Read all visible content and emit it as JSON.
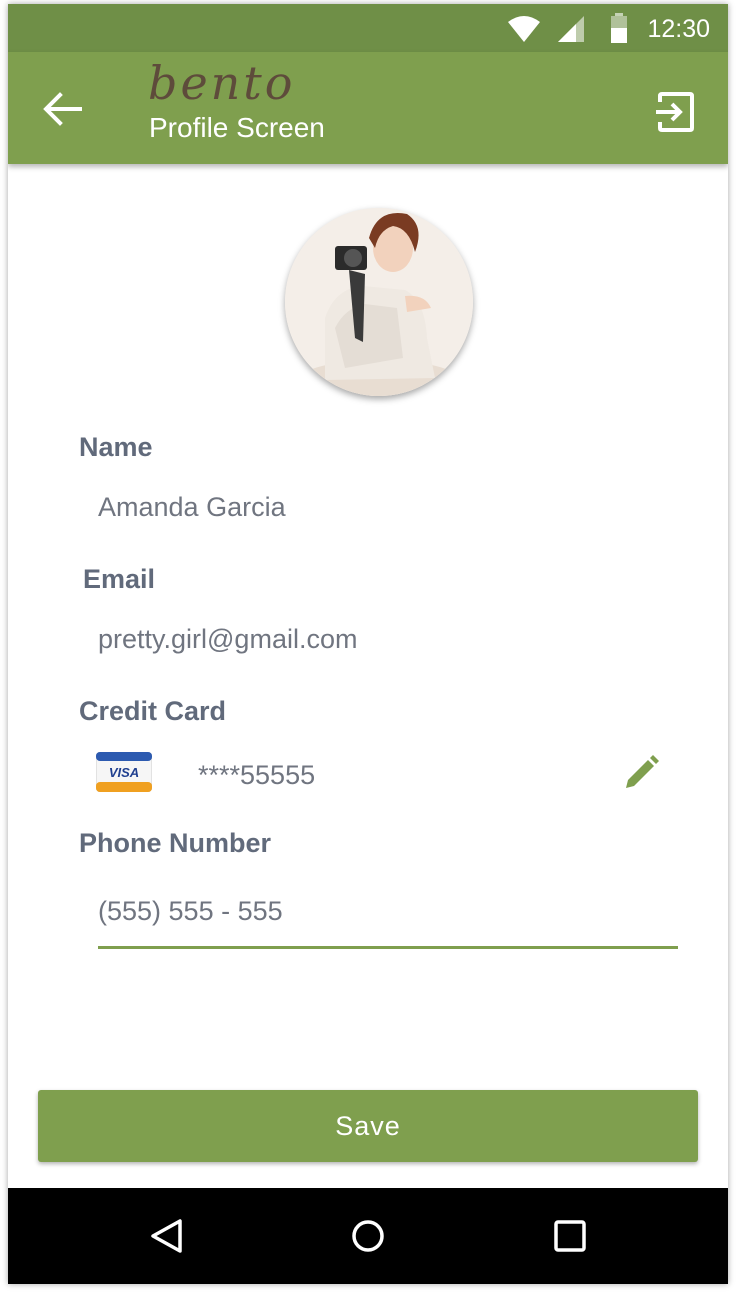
{
  "status_bar": {
    "time": "12:30",
    "icons": [
      "wifi-icon",
      "cell-signal-icon",
      "battery-icon"
    ]
  },
  "app_bar": {
    "brand": "bento",
    "title": "Profile Screen",
    "back_icon": "arrow-back-icon",
    "logout_icon": "exit-to-app-icon",
    "background": "#7f9f4e"
  },
  "profile": {
    "name_label": "Name",
    "name_value": "Amanda Garcia",
    "email_label": "Email",
    "email_value": "pretty.girl@gmail.com",
    "card_label": "Credit Card",
    "card_brand": "VISA",
    "card_number": "****55555",
    "phone_label": "Phone Number",
    "phone_value": "(555) 555 - 555"
  },
  "actions": {
    "save_label": "Save"
  },
  "nav_bar": {
    "icons": [
      "nav-back-icon",
      "nav-home-icon",
      "nav-recents-icon"
    ]
  },
  "colors": {
    "accent": "#7f9f4e",
    "status_bar": "#6f8f47",
    "label_text": "#616a7b",
    "value_text": "#707580"
  }
}
